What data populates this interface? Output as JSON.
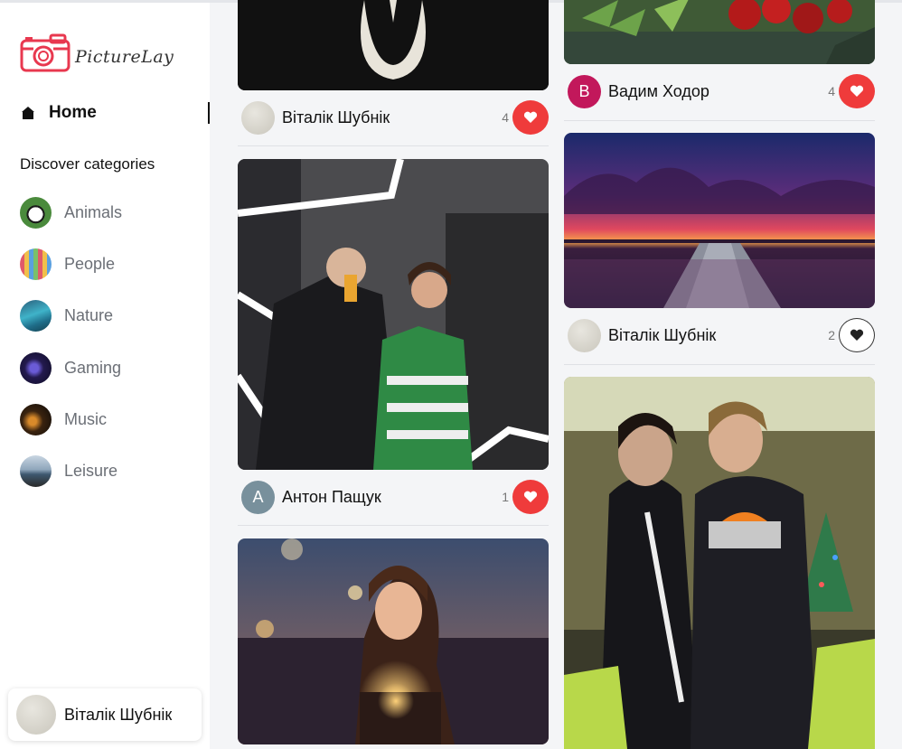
{
  "brand": {
    "name": "PictureLay",
    "accent": "#e8384f"
  },
  "nav": {
    "home_label": "Home"
  },
  "categories_heading": "Discover categories",
  "categories": [
    {
      "label": "Animals",
      "icon": "panda"
    },
    {
      "label": "People",
      "icon": "people"
    },
    {
      "label": "Nature",
      "icon": "lake"
    },
    {
      "label": "Gaming",
      "icon": "game"
    },
    {
      "label": "Music",
      "icon": "concert"
    },
    {
      "label": "Leisure",
      "icon": "beach"
    }
  ],
  "current_user": {
    "name": "Віталік Шубнік"
  },
  "pins": [
    {
      "author": "Віталік Шубнік",
      "initial": "",
      "likes": "4",
      "liked": true
    },
    {
      "author": "Антон Пащук",
      "initial": "А",
      "likes": "1",
      "liked": true
    },
    {
      "author": "Вадим Ходор",
      "initial": "В",
      "likes": "4",
      "liked": true
    },
    {
      "author": "Віталік Шубнік",
      "initial": "",
      "likes": "2",
      "liked": false
    }
  ],
  "colors": {
    "liked_heart_bg": "#ef3b3b",
    "avatar_a": "#78909c",
    "avatar_b": "#c2185b"
  }
}
